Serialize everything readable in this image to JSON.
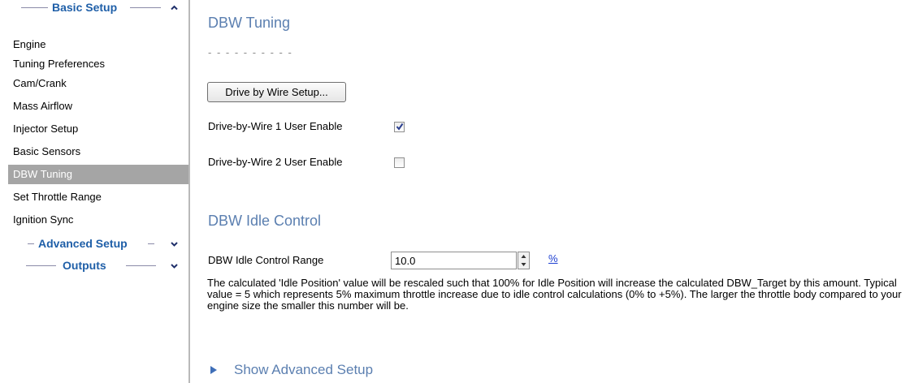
{
  "sidebar": {
    "sections": [
      {
        "title": "Basic Setup",
        "expanded": true
      },
      {
        "title": "Advanced Setup",
        "expanded": false
      },
      {
        "title": "Outputs",
        "expanded": false
      }
    ],
    "basic_items": [
      {
        "label": "Engine"
      },
      {
        "label": "Tuning Preferences"
      },
      {
        "label": "Cam/Crank"
      },
      {
        "label": "Mass Airflow"
      },
      {
        "label": "Injector Setup"
      },
      {
        "label": "Basic Sensors"
      },
      {
        "label": "DBW Tuning",
        "selected": true
      },
      {
        "label": "Set Throttle Range"
      },
      {
        "label": "Ignition Sync"
      }
    ]
  },
  "main": {
    "title": "DBW Tuning",
    "placeholder": "- - - - - - - - - -",
    "setup_button": "Drive by Wire Setup...",
    "dbw1": {
      "label": "Drive-by-Wire 1 User Enable",
      "checked": true
    },
    "dbw2": {
      "label": "Drive-by-Wire 2 User Enable",
      "checked": false
    },
    "idle_section": {
      "title": "DBW Idle Control",
      "range_label": "DBW Idle Control Range",
      "range_value": "10.0",
      "unit": "%",
      "description": "The calculated 'Idle Position' value will be rescaled such that 100% for Idle Position will increase the calculated DBW_Target by this amount. Typical value = 5 which represents 5% maximum throttle increase due to idle control calculations (0% to +5%).  The larger the throttle body compared to your engine size the smaller this number will be."
    },
    "advanced_toggle": "Show Advanced Setup"
  },
  "colors": {
    "accent_heading": "#5b7fb0",
    "sidebar_title": "#1f5fa8",
    "selected_bg": "#a5a5a5",
    "link": "#1d3fd1"
  },
  "icons": {
    "collapse": "chevron-up-icon",
    "expand": "chevron-down-icon",
    "checkmark": "checkmark-icon",
    "spinner": "spin-up-down-icon",
    "disclosure": "triangle-right-icon"
  }
}
